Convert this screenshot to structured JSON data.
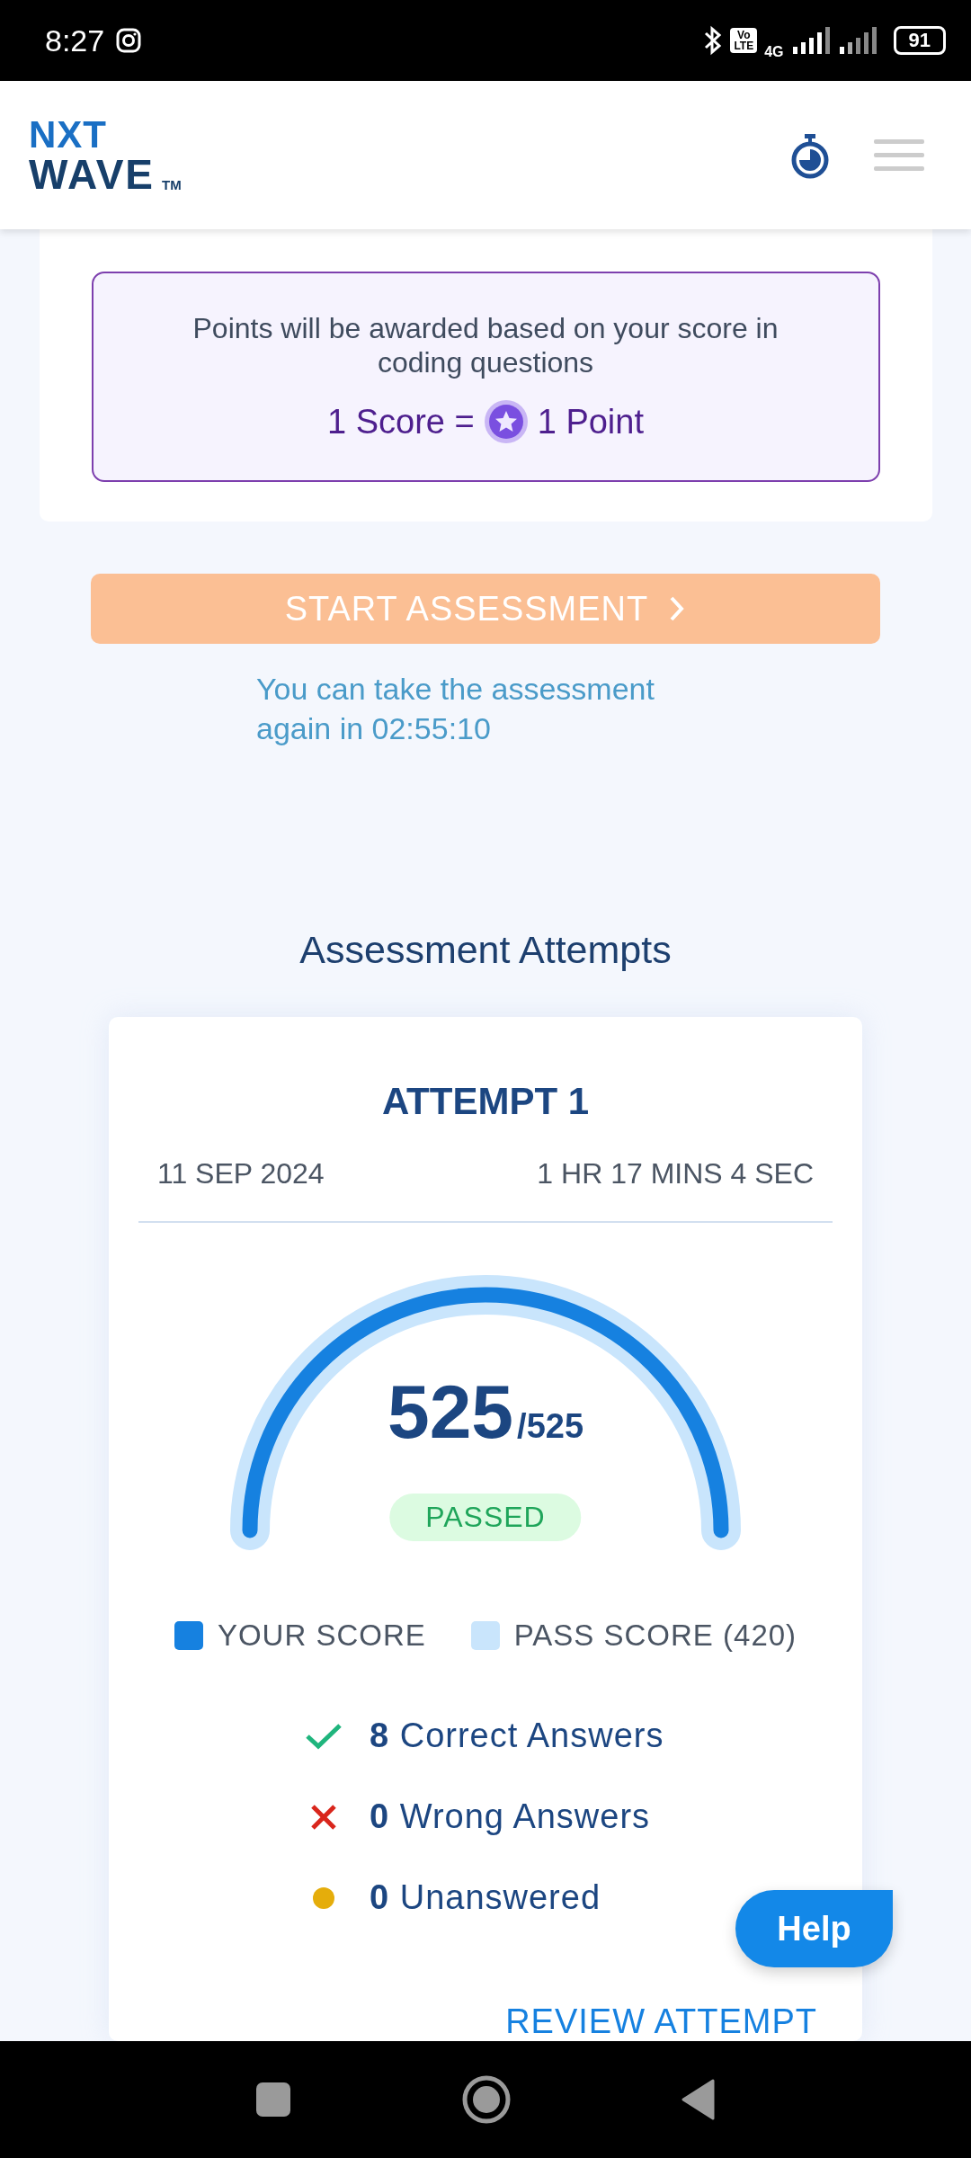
{
  "status_bar": {
    "time": "8:27",
    "volte": [
      "Vo",
      "LTE"
    ],
    "network": "4G",
    "battery": "91"
  },
  "header": {
    "logo": {
      "line1": "NXT",
      "line2": "WAVE",
      "mark": "TM"
    }
  },
  "points_info": {
    "text": "Points will be awarded based on your score in coding questions",
    "left": "1 Score =",
    "right": "1 Point"
  },
  "start_button": {
    "label": "START ASSESSMENT",
    "disabled": true
  },
  "retake_note": "You can take the assessment again in 02:55:10",
  "attempts_title": "Assessment Attempts",
  "attempt": {
    "title": "ATTEMPT 1",
    "date": "11 SEP 2024",
    "duration": "1 HR 17 MINS 4 SEC",
    "score": "525",
    "total": "/525",
    "level": 1,
    "result": "PASSED",
    "legend": [
      {
        "label": "YOUR SCORE",
        "color": "#1681e0"
      },
      {
        "label": "PASS SCORE (420)",
        "color": "#c9e5fc"
      }
    ],
    "stats": [
      {
        "kind": "correct",
        "count": "8",
        "label": "Correct Answers"
      },
      {
        "kind": "wrong",
        "count": "0",
        "label": "Wrong Answers"
      },
      {
        "kind": "unanswered",
        "count": "0",
        "label": "Unanswered"
      }
    ],
    "review_link": "REVIEW ATTEMPT"
  },
  "help_button": "Help"
}
